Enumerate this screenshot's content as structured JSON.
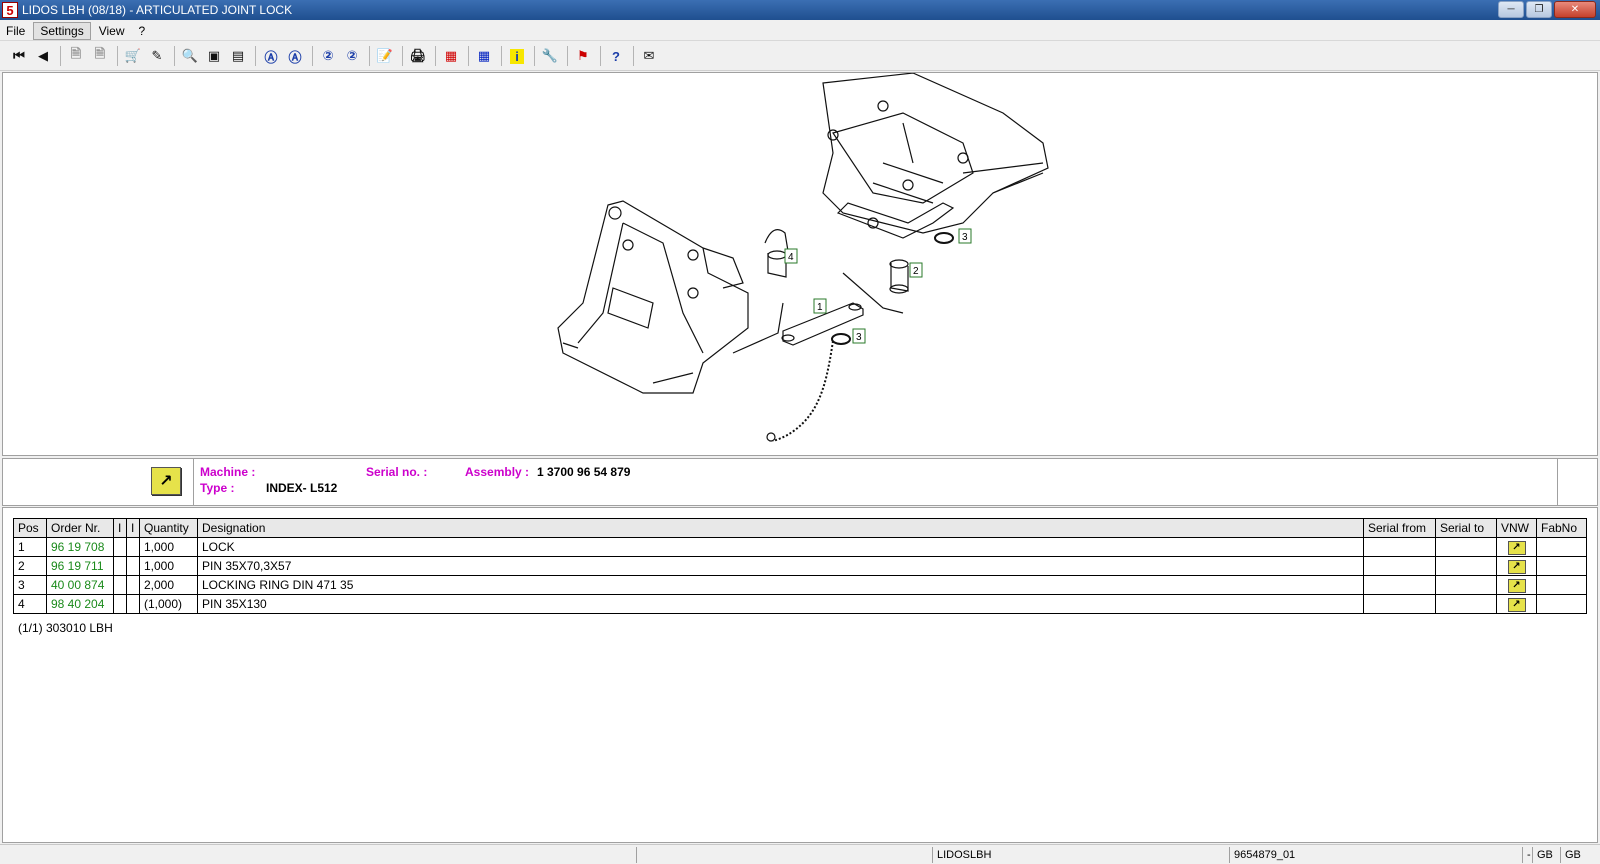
{
  "window": {
    "app_icon": "5",
    "title": "LIDOS LBH (08/18) - ARTICULATED JOINT LOCK",
    "minimize_icon": "minimize-icon",
    "maximize_icon": "restore-icon",
    "close_icon": "close-icon"
  },
  "menu": {
    "file": "File",
    "settings": "Settings",
    "view": "View",
    "help": "?"
  },
  "toolbar_icons": [
    "first-page-icon",
    "previous-page-icon",
    "page-back-icon",
    "page-forward-icon",
    "cart-icon",
    "edit-list-icon",
    "zoom-in-icon",
    "fit-page-icon",
    "fit-width-icon",
    "find-a-icon",
    "find-b-icon",
    "find-2-icon",
    "find-3-icon",
    "note-icon",
    "print-icon",
    "grid-red-icon",
    "grid-blue-icon",
    "info-icon",
    "tools-icon",
    "lidos-flag-icon",
    "lidos-help-icon",
    "mail-icon"
  ],
  "drawing": {
    "callouts": [
      "1",
      "2",
      "3",
      "3",
      "4"
    ]
  },
  "info": {
    "machine_label": "Machine :",
    "machine_value": "",
    "serial_label": "Serial no. :",
    "serial_value": "",
    "assembly_label": "Assembly :",
    "assembly_value": "1 3700 96 54 879",
    "type_label": "Type :",
    "type_value": "INDEX- L512"
  },
  "table": {
    "headers": [
      "Pos",
      "Order Nr.",
      "I",
      "I",
      "Quantity",
      "Designation",
      "Serial from",
      "Serial to",
      "VNW",
      "FabNo"
    ],
    "rows": [
      {
        "pos": "1",
        "order": "96 19 708",
        "i1": "",
        "i2": "",
        "qty": "1,000",
        "designation": "LOCK",
        "serial_from": "",
        "serial_to": "",
        "fabno": ""
      },
      {
        "pos": "2",
        "order": "96 19 711",
        "i1": "",
        "i2": "",
        "qty": "1,000",
        "designation": "PIN 35X70,3X57",
        "serial_from": "",
        "serial_to": "",
        "fabno": ""
      },
      {
        "pos": "3",
        "order": "40 00 874",
        "i1": "",
        "i2": "",
        "qty": "2,000",
        "designation": "LOCKING RING DIN 471 35",
        "serial_from": "",
        "serial_to": "",
        "fabno": ""
      },
      {
        "pos": "4",
        "order": "98 40 204",
        "i1": "",
        "i2": "",
        "qty": "(1,000)",
        "designation": "PIN 35X130",
        "serial_from": "",
        "serial_to": "",
        "fabno": ""
      }
    ],
    "footer": "(1/1) 303010 LBH"
  },
  "status": {
    "app": "LIDOSLBH",
    "doc": "9654879_01",
    "dash": "-",
    "lang1": "GB",
    "lang2": "GB"
  },
  "colors": {
    "label_magenta": "#cc00cc",
    "order_green": "#1a8a1a",
    "icon_yellow": "#e6e24a"
  }
}
